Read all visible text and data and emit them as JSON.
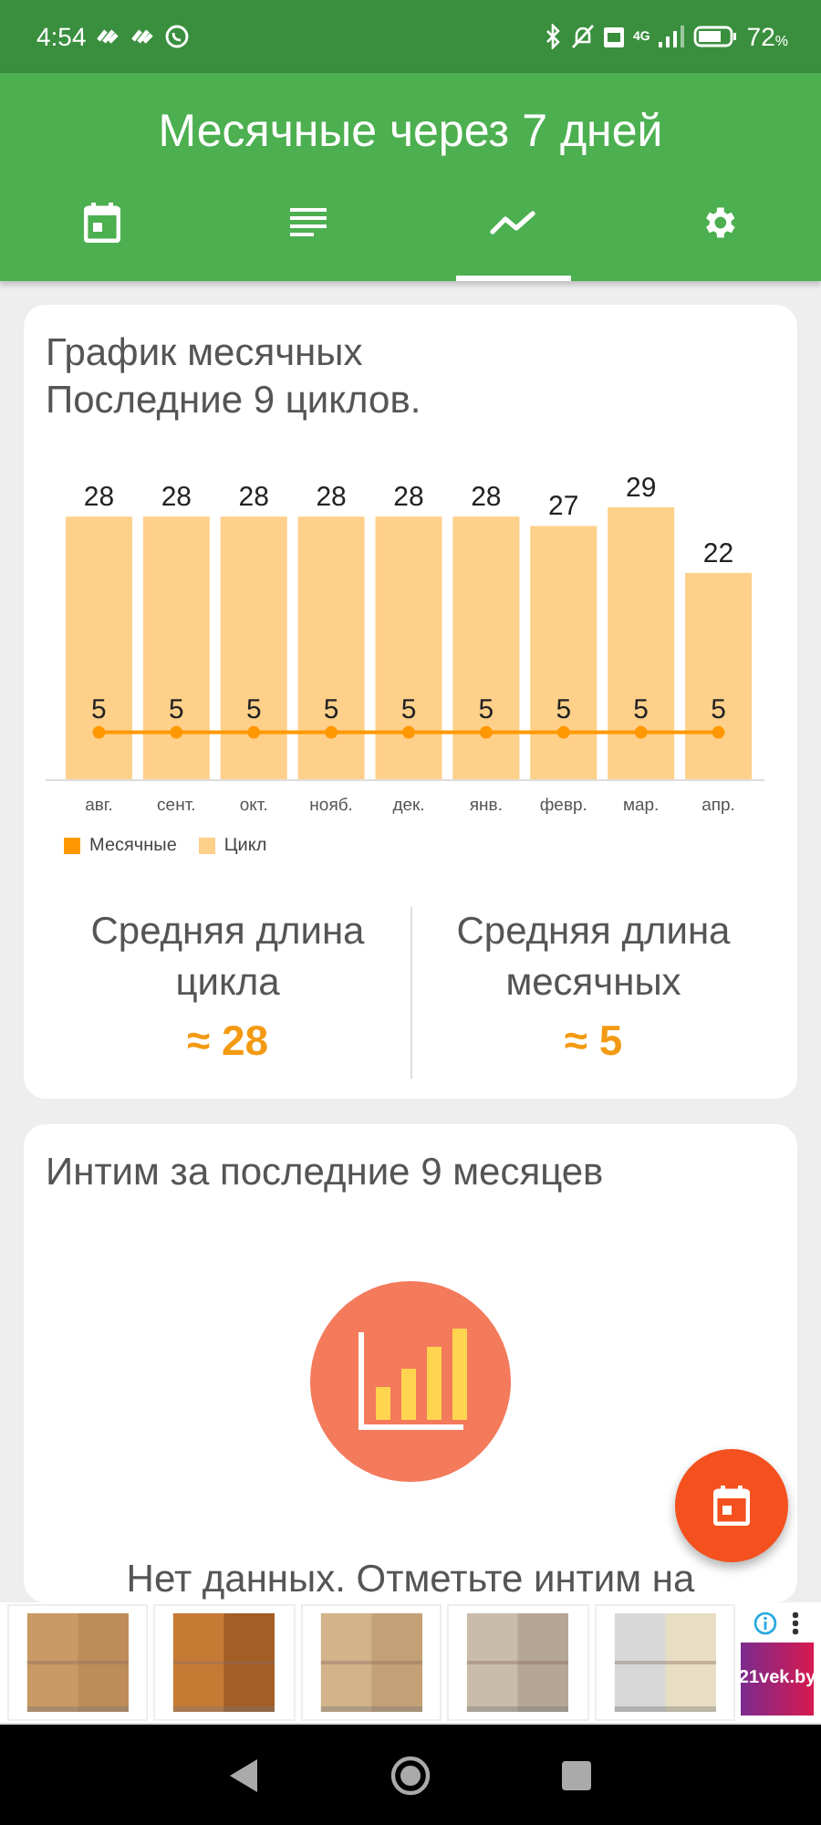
{
  "status_bar": {
    "time": "4:54",
    "battery": "72",
    "battery_unit": "%",
    "network": "4G"
  },
  "app_bar": {
    "title": "Месячные через 7 дней"
  },
  "tabs": [
    {
      "selected": false
    },
    {
      "selected": false
    },
    {
      "selected": true
    },
    {
      "selected": false
    }
  ],
  "cycle_card": {
    "title": "График месячных",
    "subtitle": "Последние 9 циклов.",
    "chart_data": {
      "type": "bar",
      "categories": [
        "авг.",
        "сент.",
        "окт.",
        "нояб.",
        "дек.",
        "янв.",
        "февр.",
        "мар.",
        "апр."
      ],
      "data_labels": true,
      "legend": "bottom-left",
      "series": [
        {
          "name": "Месячные",
          "type": "line",
          "marker": "circle",
          "color": "#ff9800",
          "values": [
            5,
            5,
            5,
            5,
            5,
            5,
            5,
            5,
            5
          ]
        },
        {
          "name": "Цикл",
          "color": "#ffd08a",
          "values": [
            28,
            28,
            28,
            28,
            28,
            28,
            27,
            29,
            22
          ]
        }
      ]
    },
    "stats": [
      {
        "label": "Средняя длина цикла",
        "value": "≈ 28"
      },
      {
        "label": "Средняя длина месячных",
        "value": "≈ 5"
      }
    ]
  },
  "intimacy_card": {
    "title": "Интим за последние 9 месяцев",
    "message": "Нет данных. Отметьте интим на"
  },
  "ad": {
    "logo": "21vek.by"
  }
}
